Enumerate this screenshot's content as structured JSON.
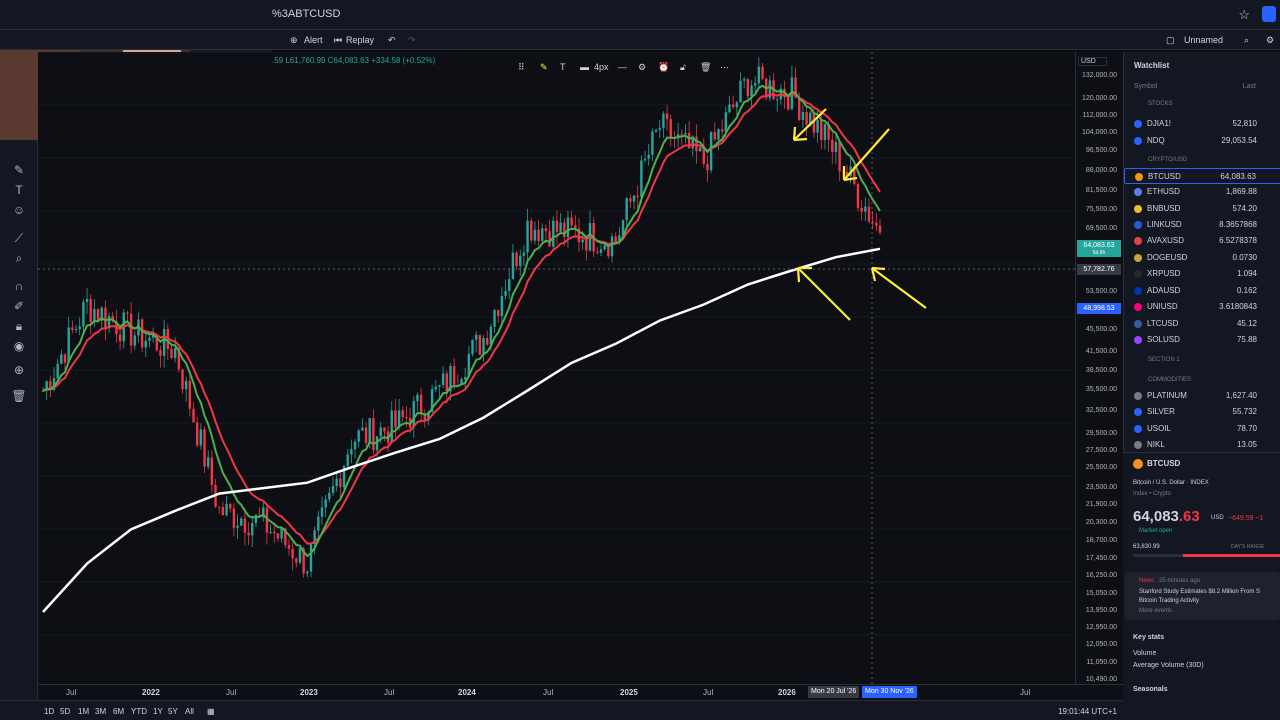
{
  "topbar": {
    "symbol": "%3ABTCUSD",
    "star_icon": "star-icon"
  },
  "toolbar": {
    "alert": "Alert",
    "replay": "Replay",
    "layout_name": "Unnamed"
  },
  "ohlc_text": ".59 L61,760.99 C64,083.63 +334.58 (+0.52%)",
  "drawbar": {
    "stroke_width": "4px"
  },
  "price_axis": {
    "currency": "USD",
    "ticks": [
      "132,000.00",
      "120,000.00",
      "112,000.00",
      "104,000.00",
      "96,500.00",
      "88,000.00",
      "81,500.00",
      "75,500.00",
      "69,500.00",
      "53,500.00",
      "45,500.00",
      "41,500.00",
      "38,500.00",
      "35,500.00",
      "32,500.00",
      "29,500.00",
      "27,500.00",
      "25,500.00",
      "23,500.00",
      "21,900.00",
      "20,300.00",
      "18,700.00",
      "17,450.00",
      "16,250.00",
      "15,050.00",
      "13,950.00",
      "12,950.00",
      "12,050.00",
      "11,050.00",
      "10,490.00"
    ],
    "badge_current": "64,083.63",
    "badge_current_sub": "5d 6h",
    "badge_cross": "57,782.76",
    "badge_low": "48,998.53"
  },
  "time_axis": {
    "labels": [
      "Jul",
      "2022",
      "Jul",
      "2023",
      "Jul",
      "2024",
      "Jul",
      "2025",
      "Jul",
      "2026",
      "Jul"
    ],
    "crosshair_start": "Mon 20 Jul '26",
    "crosshair_end": "Mon 30 Nov '26"
  },
  "bottombar": {
    "ranges": [
      "1D",
      "5D",
      "1M",
      "3M",
      "6M",
      "YTD",
      "1Y",
      "5Y",
      "All"
    ],
    "clock": "19:01:44 UTC+1"
  },
  "watchlist": {
    "title": "Watchlist",
    "col_symbol": "Symbol",
    "col_last": "Last",
    "sections": {
      "stocks": "STOCKS",
      "crypto": "CRYPTO/USD",
      "section1": "SECTION 1",
      "commodities": "COMMODITIES"
    },
    "rows": [
      {
        "symbol": "DJIA1!",
        "last": "52,810",
        "color": "#2962ff"
      },
      {
        "symbol": "NDQ",
        "last": "29,053.54",
        "color": "#2962ff"
      },
      {
        "symbol": "BTCUSD",
        "last": "64,083.63",
        "color": "#f7931a"
      },
      {
        "symbol": "ETHUSD",
        "last": "1,869.88",
        "color": "#627eea"
      },
      {
        "symbol": "BNBUSD",
        "last": "574.20",
        "color": "#f3ba2f"
      },
      {
        "symbol": "LINKUSD",
        "last": "8.3657868",
        "color": "#2a5ada"
      },
      {
        "symbol": "AVAXUSD",
        "last": "6.5278378",
        "color": "#e84142"
      },
      {
        "symbol": "DOGEUSD",
        "last": "0.0730",
        "color": "#c2a633"
      },
      {
        "symbol": "XRPUSD",
        "last": "1.094",
        "color": "#23292f"
      },
      {
        "symbol": "ADAUSD",
        "last": "0.162",
        "color": "#0033ad"
      },
      {
        "symbol": "UNIUSD",
        "last": "3.6180843",
        "color": "#ff007a"
      },
      {
        "symbol": "LTCUSD",
        "last": "45.12",
        "color": "#345d9d"
      },
      {
        "symbol": "SOLUSD",
        "last": "75.88",
        "color": "#9945ff"
      },
      {
        "symbol": "PLATINUM",
        "last": "1,627.40",
        "color": "#787b86"
      },
      {
        "symbol": "SILVER",
        "last": "55.732",
        "color": "#2962ff"
      },
      {
        "symbol": "USOIL",
        "last": "78.70",
        "color": "#2962ff"
      },
      {
        "symbol": "NIKL",
        "last": "13.05",
        "color": "#787b86"
      }
    ]
  },
  "detail": {
    "symbol": "BTCUSD",
    "name": "Bitcoin / U.S. Dollar",
    "exchange": "INDEX",
    "type": "Index • Crypto",
    "price_main": "64,083",
    "price_frac": ".63",
    "currency": "USD",
    "change": "−649.59 −1",
    "market_status": "Market open",
    "day_low": "63,830.99",
    "day_range_label": "DAY'S RANGE",
    "news_label": "News",
    "news_ago": "25 minutes ago",
    "news_text": "Stanford Study Estimates $8.2 Million From S Bitcoin Trading Activity",
    "news_more": "More events",
    "key_stats": "Key stats",
    "volume": "Volume",
    "avg_volume": "Average Volume (30D)",
    "seasonals": "Seasonals"
  },
  "chart_data": {
    "type": "line",
    "title": "",
    "xlabel": "",
    "ylabel": "",
    "log_scale": true,
    "x": [
      "2021-07",
      "2021-10",
      "2022-01",
      "2022-04",
      "2022-07",
      "2022-10",
      "2023-01",
      "2023-04",
      "2023-07",
      "2023-10",
      "2024-01",
      "2024-04",
      "2024-07",
      "2024-10",
      "2025-01",
      "2025-04",
      "2025-07",
      "2025-10",
      "2026-01",
      "2026-02"
    ],
    "series": [
      {
        "values": [
          34000,
          48000,
          43000,
          40000,
          21000,
          20000,
          17000,
          28000,
          29500,
          34000,
          42000,
          66000,
          64000,
          62000,
          98000,
          85000,
          118000,
          112000,
          88000,
          64000
        ]
      },
      {
        "values": [
          14000,
          17000,
          19500,
          21000,
          22500,
          23000,
          23500,
          25000,
          26500,
          28000,
          30500,
          34000,
          38000,
          41000,
          45000,
          48000,
          52000,
          55000,
          58000,
          60000
        ]
      }
    ],
    "ylim": [
      10490,
      132000
    ]
  },
  "colors": {
    "up": "#26a69a",
    "down": "#f23645",
    "accent": "#2962ff",
    "annotation": "#ffeb3b"
  }
}
